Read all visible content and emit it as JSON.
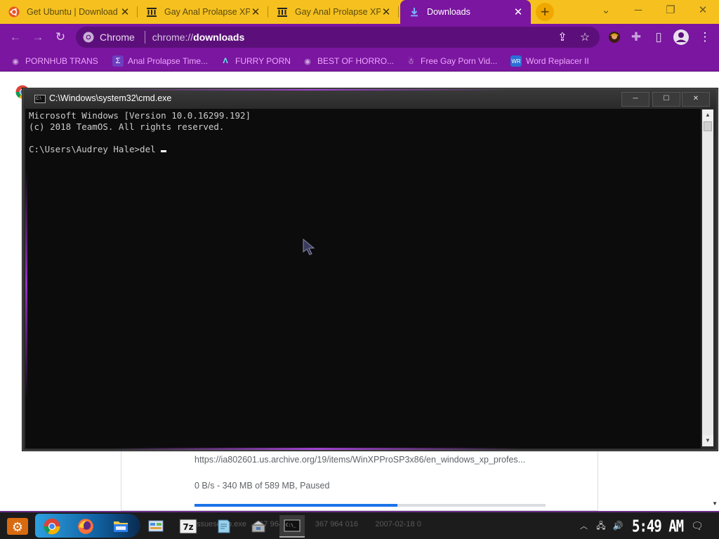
{
  "browser": {
    "tabs": [
      {
        "title": "Get Ubuntu | Download",
        "icon": "ubuntu-icon",
        "active": false
      },
      {
        "title": "Gay Anal Prolapse XP",
        "icon": "archive-org-icon",
        "active": false
      },
      {
        "title": "Gay Anal Prolapse XP",
        "icon": "archive-org-icon",
        "active": false
      },
      {
        "title": "Downloads",
        "icon": "download-icon",
        "active": true
      }
    ],
    "new_tab_glyph": "+",
    "window_controls": {
      "tab_search": "⌄",
      "minimize": "─",
      "restore": "❐",
      "close": "✕"
    },
    "toolbar": {
      "back": "←",
      "forward": "→",
      "reload": "↻"
    },
    "omnibox": {
      "site_chip": "Chrome",
      "url_scheme": "chrome://",
      "url_host": "downloads"
    },
    "bookmarks": [
      {
        "label": "PORNHUB TRANS",
        "icon": "globe-icon"
      },
      {
        "label": "Anal Prolapse Time...",
        "icon": "sigma-icon"
      },
      {
        "label": "FURRY PORN",
        "icon": "lambda-icon"
      },
      {
        "label": "BEST OF HORRO...",
        "icon": "globe-icon"
      },
      {
        "label": "Free Gay Porn Vid...",
        "icon": "ghost-icon"
      },
      {
        "label": "Word Replacer II",
        "icon": "wr-extension-icon"
      }
    ]
  },
  "downloads_page": {
    "item": {
      "url": "https://ia802601.us.archive.org/19/items/WinXPProSP3x86/en_windows_xp_profes...",
      "status": "0 B/s - 340 MB of 589 MB, Paused",
      "progress_fraction": 0.577
    }
  },
  "cmd": {
    "title": "C:\\Windows\\system32\\cmd.exe",
    "controls": {
      "minimize": "─",
      "maximize": "☐",
      "close": "✕"
    },
    "lines": [
      "Microsoft Windows [Version 10.0.16299.192]",
      "(c) 2018 TeamOS. All rights reserved.",
      ""
    ],
    "prompt": "C:\\Users\\Audrey Hale>del "
  },
  "taskbar": {
    "ghost_text": "ssuesetup.exe    367 964 016        367 964 016        2007-02-18 0",
    "clock": "5:49 AM",
    "apps": [
      "start-button",
      "chrome",
      "firefox",
      "file-explorer",
      "control-panel",
      "7zip",
      "notepad",
      "installer",
      "cmd"
    ]
  },
  "colors": {
    "tabstrip": "#f6c11f",
    "toolbar": "#7a16a0",
    "bookmark_text": "#f0a5ff",
    "console_bg": "#0c0c0c",
    "console_text": "#cccccc",
    "progress": "#1a73e8"
  }
}
